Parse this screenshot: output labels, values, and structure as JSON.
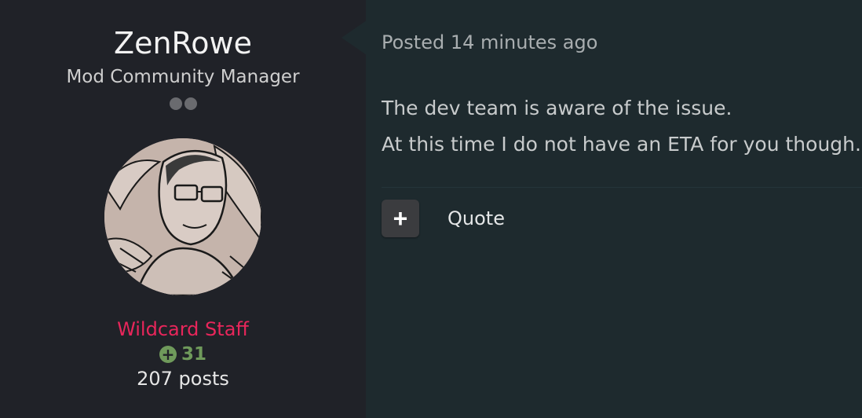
{
  "author": {
    "username": "ZenRowe",
    "title": "Mod Community Manager",
    "rank_pips": 2,
    "group": "Wildcard Staff",
    "reputation": "31",
    "reputation_icon": "plus-circle-icon",
    "posts": "207 posts"
  },
  "post": {
    "meta": "Posted 14 minutes ago",
    "lines": [
      "The dev team is aware of the issue.",
      "At this time I do not have an ETA for you though."
    ]
  },
  "actions": {
    "multiquote_symbol": "+",
    "quote_label": "Quote"
  },
  "colors": {
    "group": "#e8265b",
    "reputation": "#6f9a5b"
  }
}
